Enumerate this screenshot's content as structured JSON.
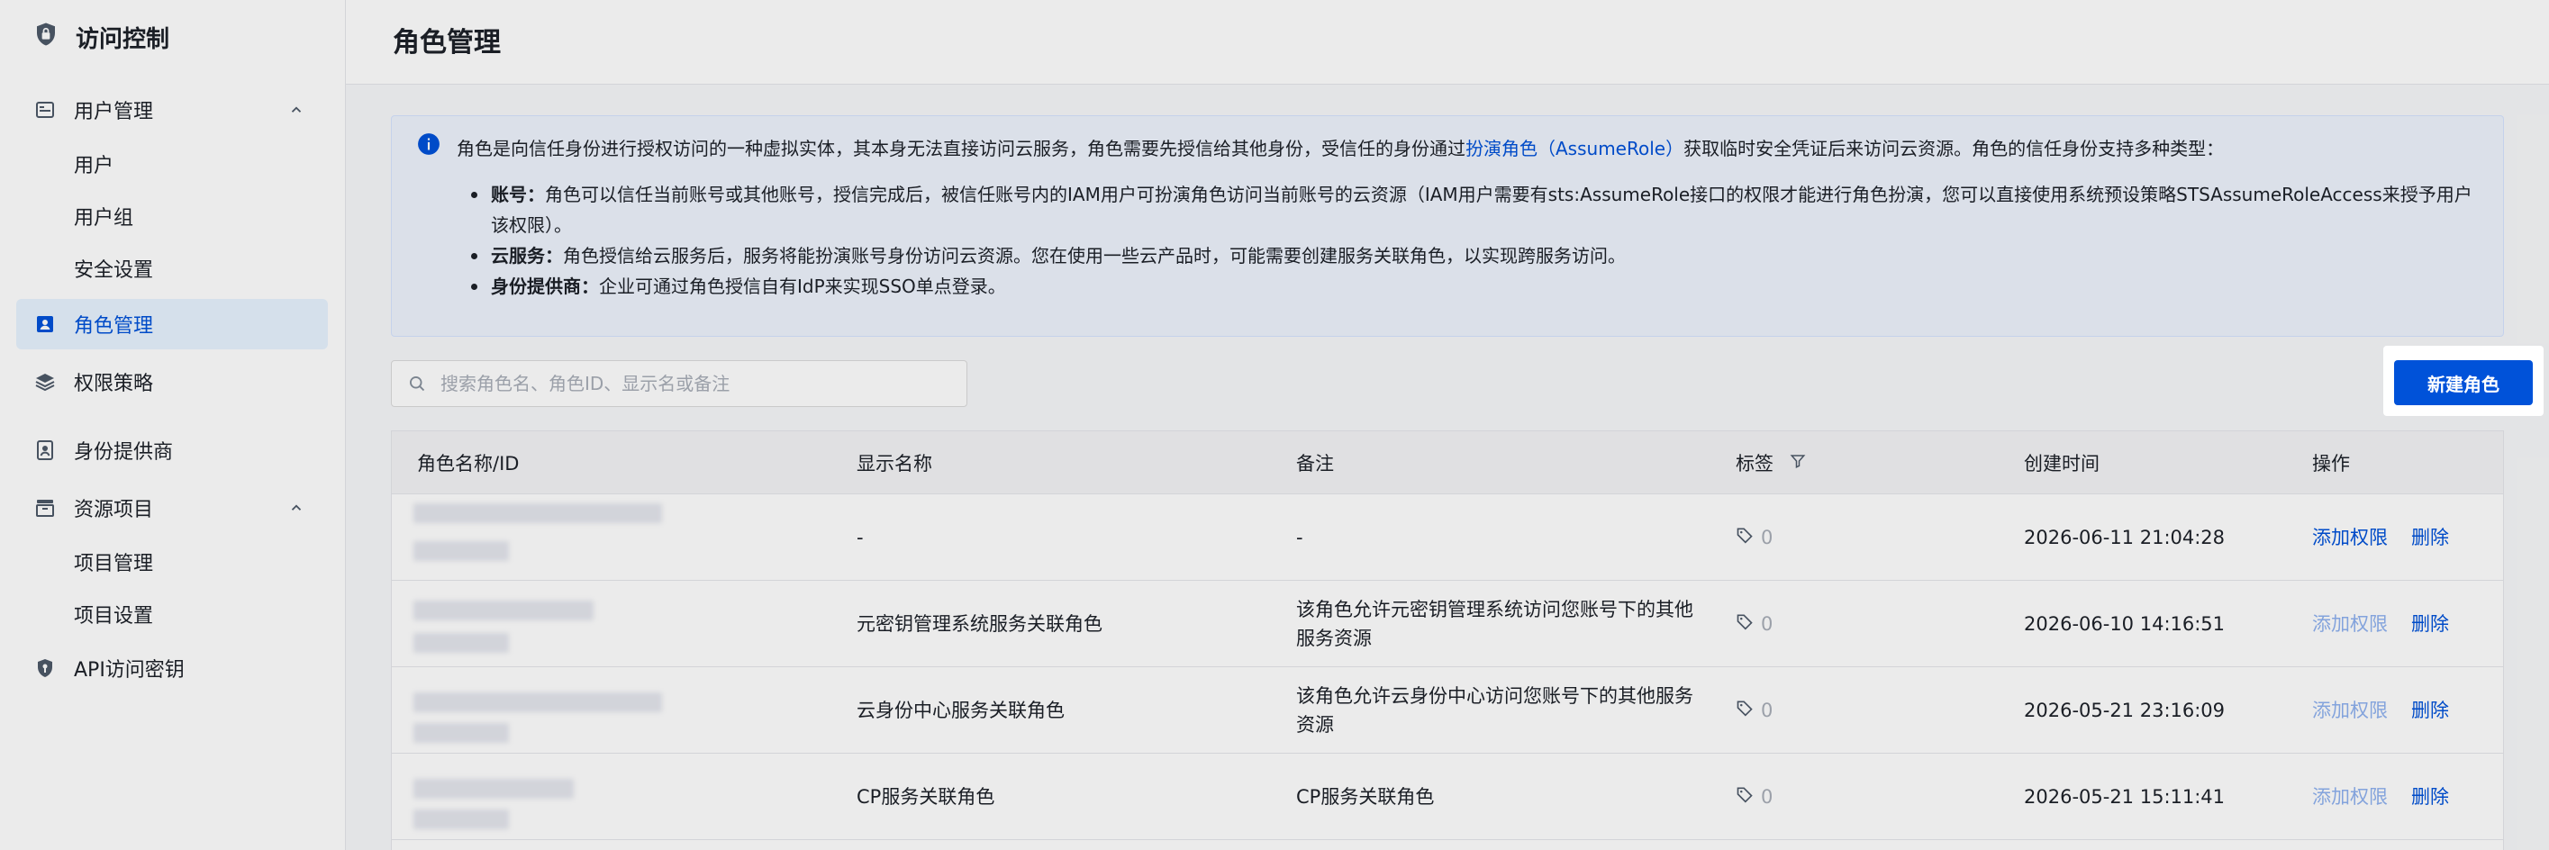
{
  "sidebar": {
    "title": "访问控制",
    "groups": {
      "user_mgmt": "用户管理",
      "resource_project": "资源项目"
    },
    "items": {
      "users": "用户",
      "user_groups": "用户组",
      "security": "安全设置",
      "roles": "角色管理",
      "policies": "权限策略",
      "idp": "身份提供商",
      "project_mgmt": "项目管理",
      "project_settings": "项目设置",
      "api_keys": "API访问密钥"
    }
  },
  "header": {
    "title": "角色管理"
  },
  "notice": {
    "intro_before": "角色是向信任身份进行授权访问的一种虚拟实体，其本身无法直接访问云服务，角色需要先授信给其他身份，受信任的身份通过",
    "intro_link": "扮演角色（AssumeRole）",
    "intro_after": "获取临时安全凭证后来访问云资源。角色的信任身份支持多种类型：",
    "items": [
      {
        "label": "账号：",
        "text": "角色可以信任当前账号或其他账号，授信完成后，被信任账号内的IAM用户可扮演角色访问当前账号的云资源（IAM用户需要有sts:AssumeRole接口的权限才能进行角色扮演，您可以直接使用系统预设策略STSAssumeRoleAccess来授予用户该权限）。"
      },
      {
        "label": "云服务：",
        "text": "角色授信给云服务后，服务将能扮演账号身份访问云资源。您在使用一些云产品时，可能需要创建服务关联角色，以实现跨服务访问。"
      },
      {
        "label": "身份提供商：",
        "text": "企业可通过角色授信自有IdP来实现SSO单点登录。"
      }
    ]
  },
  "toolbar": {
    "search_placeholder": "搜索角色名、角色ID、显示名或备注",
    "new_role": "新建角色"
  },
  "table": {
    "columns": {
      "name": "角色名称/ID",
      "display": "显示名称",
      "remark": "备注",
      "tags": "标签",
      "created": "创建时间",
      "ops": "操作"
    },
    "rows": [
      {
        "display": "-",
        "remark": "-",
        "tag_count": "0",
        "created": "2026-06-11 21:04:28",
        "op_add": "添加权限",
        "op_delete": "删除"
      },
      {
        "display": "元密钥管理系统服务关联角色",
        "remark": "该角色允许元密钥管理系统访问您账号下的其他服务资源",
        "tag_count": "0",
        "created": "2026-06-10 14:16:51",
        "op_add": "添加权限",
        "op_delete": "删除"
      },
      {
        "display": "云身份中心服务关联角色",
        "remark": "该角色允许云身份中心访问您账号下的其他服务资源",
        "tag_count": "0",
        "created": "2026-05-21 23:16:09",
        "op_add": "添加权限",
        "op_delete": "删除"
      },
      {
        "display": "CP服务关联角色",
        "remark": "CP服务关联角色",
        "tag_count": "0",
        "created": "2026-05-21 15:11:41",
        "op_add": "添加权限",
        "op_delete": "删除"
      }
    ]
  },
  "colors": {
    "primary": "#0052d9",
    "link_disabled": "#8fb1ef",
    "notice_bg": "#eef3fd"
  }
}
